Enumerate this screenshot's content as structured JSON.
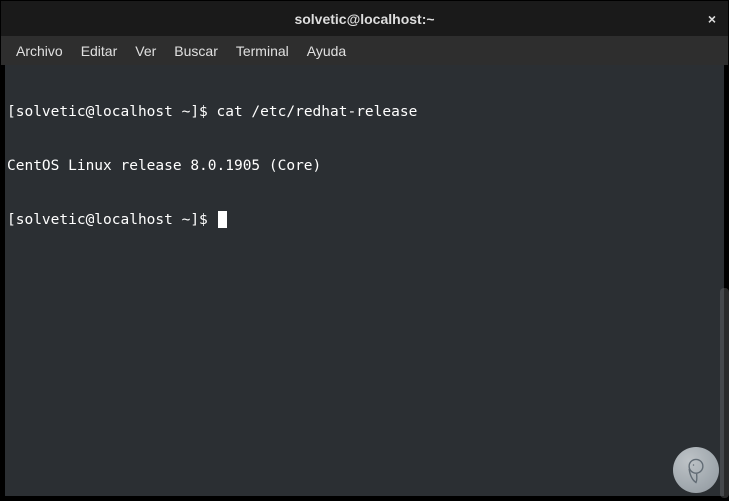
{
  "titlebar": {
    "title": "solvetic@localhost:~",
    "close_label": "×"
  },
  "menubar": {
    "items": [
      {
        "label": "Archivo"
      },
      {
        "label": "Editar"
      },
      {
        "label": "Ver"
      },
      {
        "label": "Buscar"
      },
      {
        "label": "Terminal"
      },
      {
        "label": "Ayuda"
      }
    ]
  },
  "terminal": {
    "lines": [
      {
        "prompt": "[solvetic@localhost ~]$ ",
        "command": "cat /etc/redhat-release"
      },
      {
        "output": "CentOS Linux release 8.0.1905 (Core)"
      },
      {
        "prompt": "[solvetic@localhost ~]$ ",
        "command": "",
        "cursor": true
      }
    ]
  }
}
